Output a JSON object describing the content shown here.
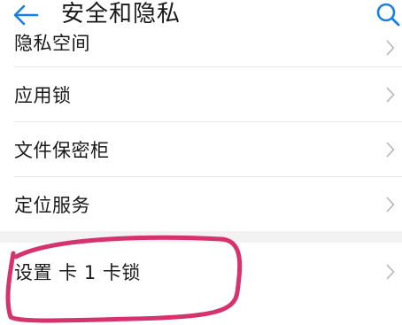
{
  "header": {
    "title": "安全和隐私",
    "back_icon": "arrow-left-icon",
    "search_icon": "search-icon",
    "accent_color": "#1a7fe0"
  },
  "settings": {
    "items": [
      {
        "label": "隐私空间"
      },
      {
        "label": "应用锁"
      },
      {
        "label": "文件保密柜"
      },
      {
        "label": "定位服务"
      }
    ],
    "sim_lock": {
      "label": "设置 卡 1 卡锁"
    }
  },
  "annotation": {
    "color": "#d6336e"
  }
}
